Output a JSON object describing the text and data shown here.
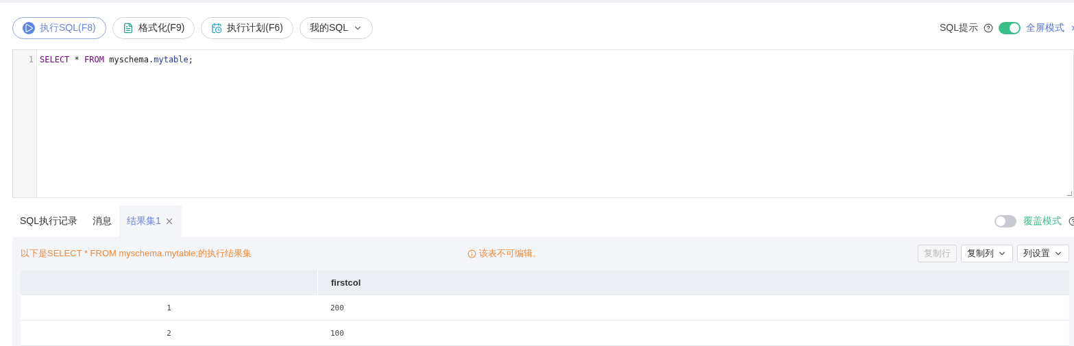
{
  "toolbar": {
    "buttons": [
      {
        "label": "执行SQL(F8)",
        "kind": "run",
        "selected": true
      },
      {
        "label": "格式化(F9)",
        "kind": "format",
        "selected": false
      },
      {
        "label": "执行计划(F6)",
        "kind": "plan",
        "selected": false
      },
      {
        "label": "我的SQL",
        "kind": "dropdown",
        "selected": false
      }
    ],
    "sql_hint": {
      "label": "SQL提示",
      "on": true
    },
    "fullscreen": {
      "label": "全屏模式"
    }
  },
  "editor": {
    "lines": [
      {
        "number": "1",
        "tokens": [
          {
            "text": "SELECT",
            "kind": "keyword"
          },
          {
            "text": " * ",
            "kind": "plain"
          },
          {
            "text": "FROM",
            "kind": "keyword"
          },
          {
            "text": " myschema.",
            "kind": "plain"
          },
          {
            "text": "mytable",
            "kind": "property"
          },
          {
            "text": ";",
            "kind": "plain"
          }
        ]
      }
    ]
  },
  "result_tabs": {
    "tabs": [
      {
        "label": "SQL执行记录",
        "selected": false,
        "closable": false
      },
      {
        "label": "消息",
        "selected": false,
        "closable": false
      },
      {
        "label": "结果集1",
        "selected": true,
        "closable": true
      }
    ],
    "overwrite_mode": {
      "label": "覆盖模式",
      "on": false
    }
  },
  "result": {
    "summary": "以下是SELECT * FROM myschema.mytable;的执行结果集",
    "warning": "该表不可编辑。",
    "actions": [
      {
        "label": "复制行",
        "disabled": true,
        "dropdown": false
      },
      {
        "label": "复制列",
        "disabled": false,
        "dropdown": true
      },
      {
        "label": "列设置",
        "disabled": false,
        "dropdown": true
      }
    ],
    "table": {
      "columns": [
        "",
        "firstcol"
      ],
      "rows": [
        [
          "1",
          "200"
        ],
        [
          "2",
          "100"
        ]
      ]
    }
  }
}
